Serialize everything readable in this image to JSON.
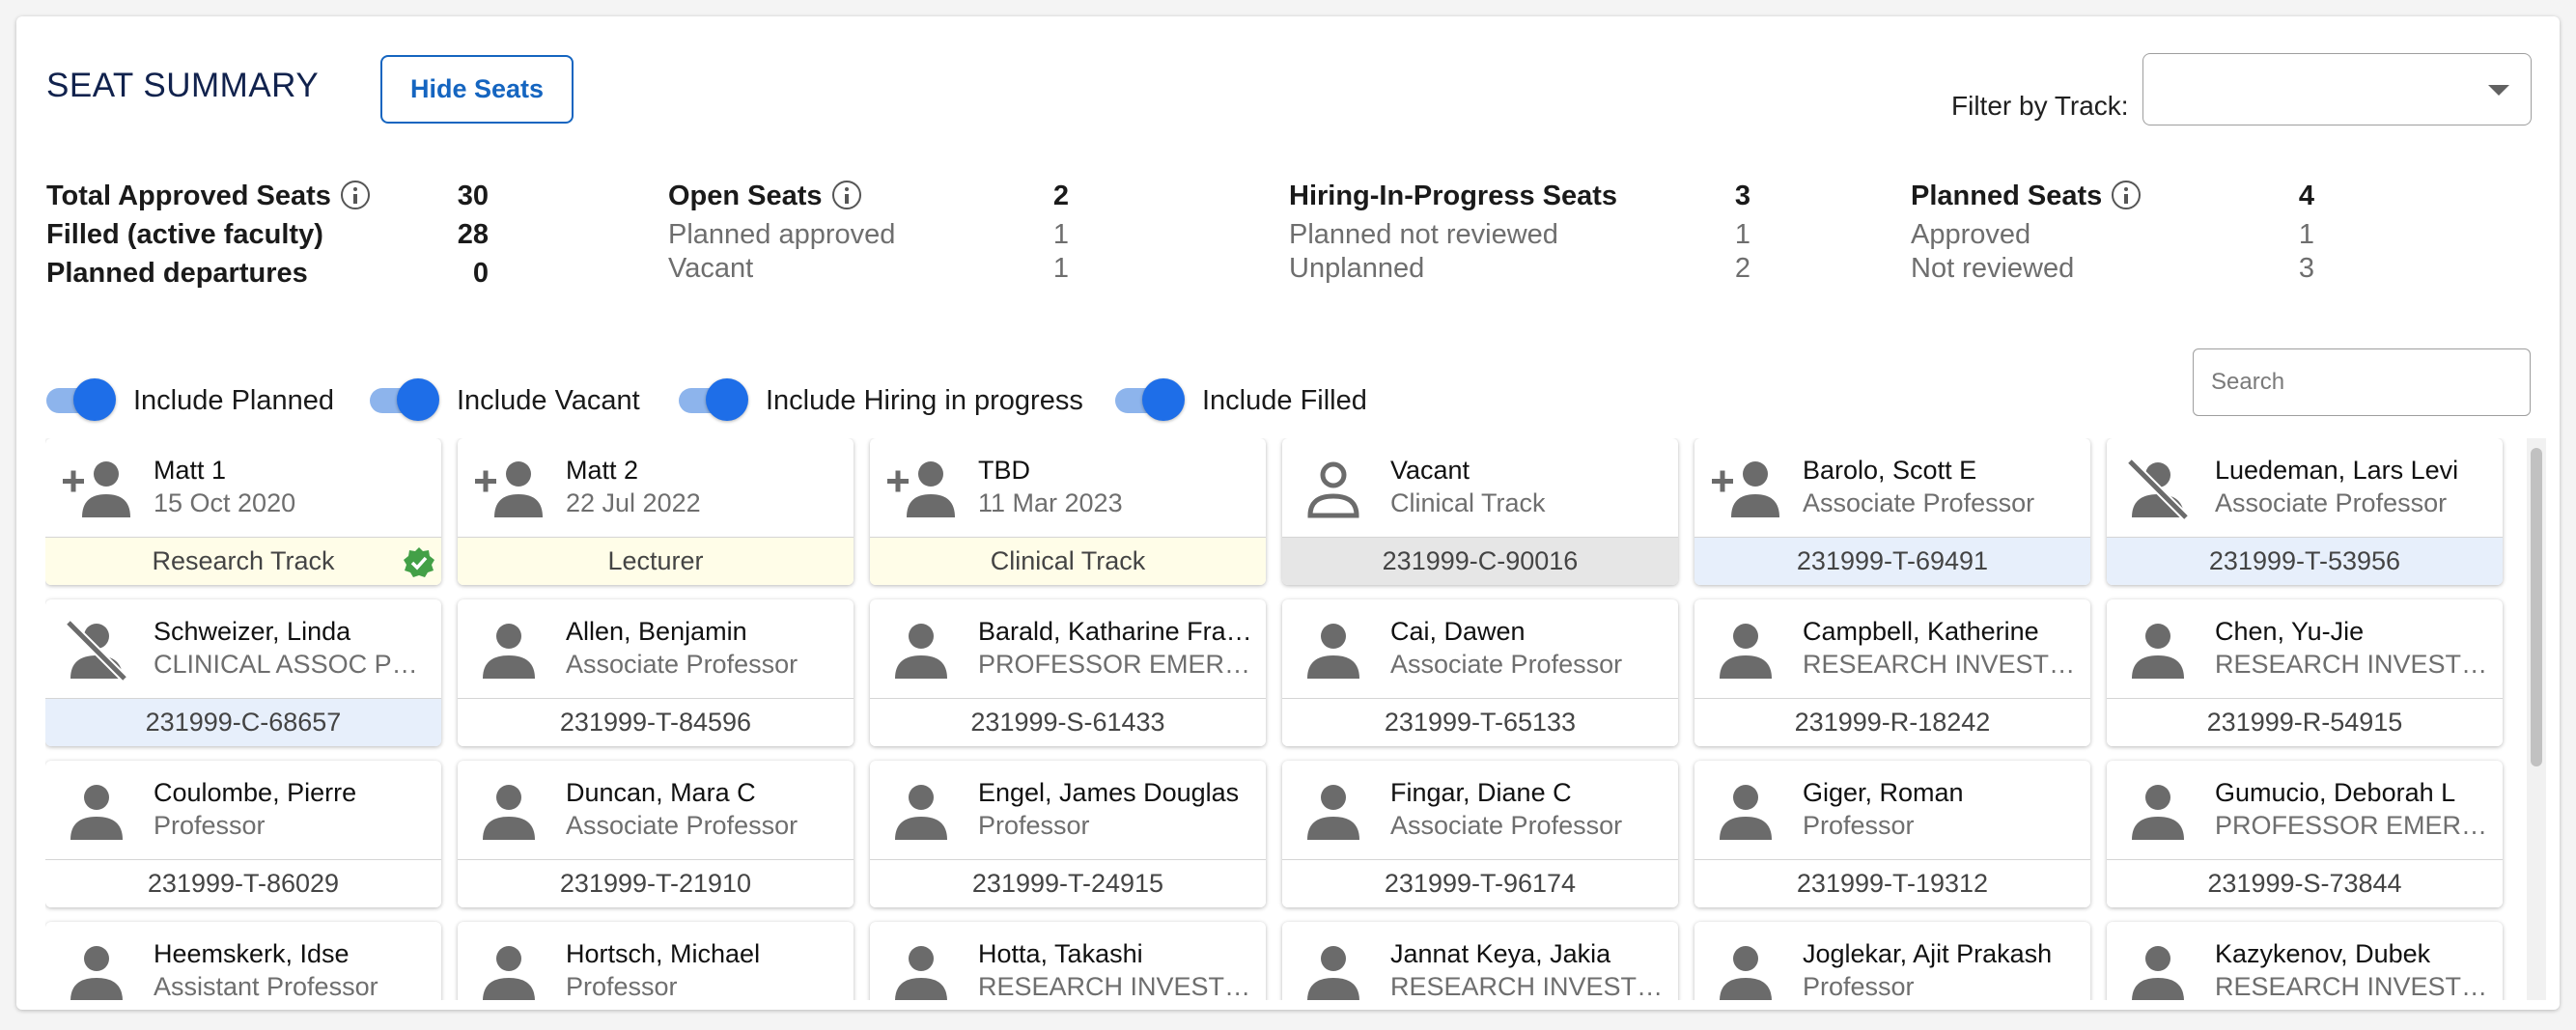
{
  "header": {
    "title": "SEAT SUMMARY",
    "hide_seats_label": "Hide Seats",
    "filter_label": "Filter by Track:",
    "filter_value": ""
  },
  "stats": {
    "total": {
      "rows": [
        {
          "label": "Total Approved Seats",
          "value": "30"
        },
        {
          "label": "Filled (active faculty)",
          "value": "28"
        },
        {
          "label": "Planned departures",
          "value": "0"
        }
      ]
    },
    "open": {
      "rows": [
        {
          "label": "Open Seats",
          "value": "2"
        },
        {
          "label": "Planned approved",
          "value": "1"
        },
        {
          "label": "Vacant",
          "value": "1"
        }
      ]
    },
    "hiring": {
      "rows": [
        {
          "label": "Hiring-In-Progress Seats",
          "value": "3"
        },
        {
          "label": "Planned not reviewed",
          "value": "1"
        },
        {
          "label": "Unplanned",
          "value": "2"
        }
      ]
    },
    "planned": {
      "rows": [
        {
          "label": "Planned Seats",
          "value": "4"
        },
        {
          "label": "Approved",
          "value": "1"
        },
        {
          "label": "Not reviewed",
          "value": "3"
        }
      ]
    }
  },
  "toggles": [
    {
      "label": "Include Planned",
      "on": true
    },
    {
      "label": "Include Vacant",
      "on": true
    },
    {
      "label": "Include Hiring in progress",
      "on": true
    },
    {
      "label": "Include Filled",
      "on": true
    }
  ],
  "search": {
    "placeholder": "Search"
  },
  "colors": {
    "accent": "#1e6ee8",
    "title": "#11224d",
    "planned_footer": "#fffde8",
    "vacant_footer": "#e6e6e6",
    "hiring_footer": "#e7effb",
    "approved_check": "#43a047"
  },
  "cards": [
    {
      "name": "Matt 1",
      "sub": "15 Oct 2020",
      "footer": "Research Track",
      "icon": "person-add-icon",
      "style": "yellow",
      "check": true
    },
    {
      "name": "Matt 2",
      "sub": "22 Jul 2022",
      "footer": "Lecturer",
      "icon": "person-add-icon",
      "style": "yellow"
    },
    {
      "name": "TBD",
      "sub": "11 Mar 2023",
      "footer": "Clinical Track",
      "icon": "person-add-icon",
      "style": "yellow"
    },
    {
      "name": "Vacant",
      "sub": "Clinical Track",
      "footer": "231999-C-90016",
      "icon": "person-outline-icon",
      "style": "grey-bg"
    },
    {
      "name": "Barolo, Scott E",
      "sub": "Associate Professor",
      "footer": "231999-T-69491",
      "icon": "person-add-icon",
      "style": "blue"
    },
    {
      "name": "Luedeman, Lars Levi",
      "sub": "Associate Professor",
      "footer": "231999-T-53956",
      "icon": "person-off-icon",
      "style": "blue"
    },
    {
      "name": "Schweizer, Linda",
      "sub": "CLINICAL ASSOC PROFESSOR",
      "footer": "231999-C-68657",
      "icon": "person-off-icon",
      "style": "blue"
    },
    {
      "name": "Allen, Benjamin",
      "sub": "Associate Professor",
      "footer": "231999-T-84596",
      "icon": "person-icon",
      "style": "white"
    },
    {
      "name": "Barald, Katharine Francis",
      "sub": "PROFESSOR EMERITUS",
      "footer": "231999-S-61433",
      "icon": "person-icon",
      "style": "white"
    },
    {
      "name": "Cai, Dawen",
      "sub": "Associate Professor",
      "footer": "231999-T-65133",
      "icon": "person-icon",
      "style": "white"
    },
    {
      "name": "Campbell, Katherine",
      "sub": "RESEARCH INVESTIGATOR",
      "footer": "231999-R-18242",
      "icon": "person-icon",
      "style": "white"
    },
    {
      "name": "Chen, Yu-Jie",
      "sub": "RESEARCH INVESTIGATOR",
      "footer": "231999-R-54915",
      "icon": "person-icon",
      "style": "white"
    },
    {
      "name": "Coulombe, Pierre",
      "sub": "Professor",
      "footer": "231999-T-86029",
      "icon": "person-icon",
      "style": "white"
    },
    {
      "name": "Duncan, Mara C",
      "sub": "Associate Professor",
      "footer": "231999-T-21910",
      "icon": "person-icon",
      "style": "white"
    },
    {
      "name": "Engel, James Douglas",
      "sub": "Professor",
      "footer": "231999-T-24915",
      "icon": "person-icon",
      "style": "white"
    },
    {
      "name": "Fingar, Diane C",
      "sub": "Associate Professor",
      "footer": "231999-T-96174",
      "icon": "person-icon",
      "style": "white"
    },
    {
      "name": "Giger, Roman",
      "sub": "Professor",
      "footer": "231999-T-19312",
      "icon": "person-icon",
      "style": "white"
    },
    {
      "name": "Gumucio, Deborah L",
      "sub": "PROFESSOR EMERITUS",
      "footer": "231999-S-73844",
      "icon": "person-icon",
      "style": "white"
    },
    {
      "name": "Heemskerk, Idse",
      "sub": "Assistant Professor",
      "footer": "",
      "icon": "person-icon",
      "style": "white"
    },
    {
      "name": "Hortsch, Michael",
      "sub": "Professor",
      "footer": "",
      "icon": "person-icon",
      "style": "white"
    },
    {
      "name": "Hotta, Takashi",
      "sub": "RESEARCH INVESTIGATOR",
      "footer": "",
      "icon": "person-icon",
      "style": "white"
    },
    {
      "name": "Jannat Keya, Jakia",
      "sub": "RESEARCH INVESTIGATOR",
      "footer": "",
      "icon": "person-icon",
      "style": "white"
    },
    {
      "name": "Joglekar, Ajit Prakash",
      "sub": "Professor",
      "footer": "",
      "icon": "person-icon",
      "style": "white"
    },
    {
      "name": "Kazykenov, Dubek",
      "sub": "RESEARCH INVESTIGATOR",
      "footer": "",
      "icon": "person-icon",
      "style": "white"
    }
  ]
}
